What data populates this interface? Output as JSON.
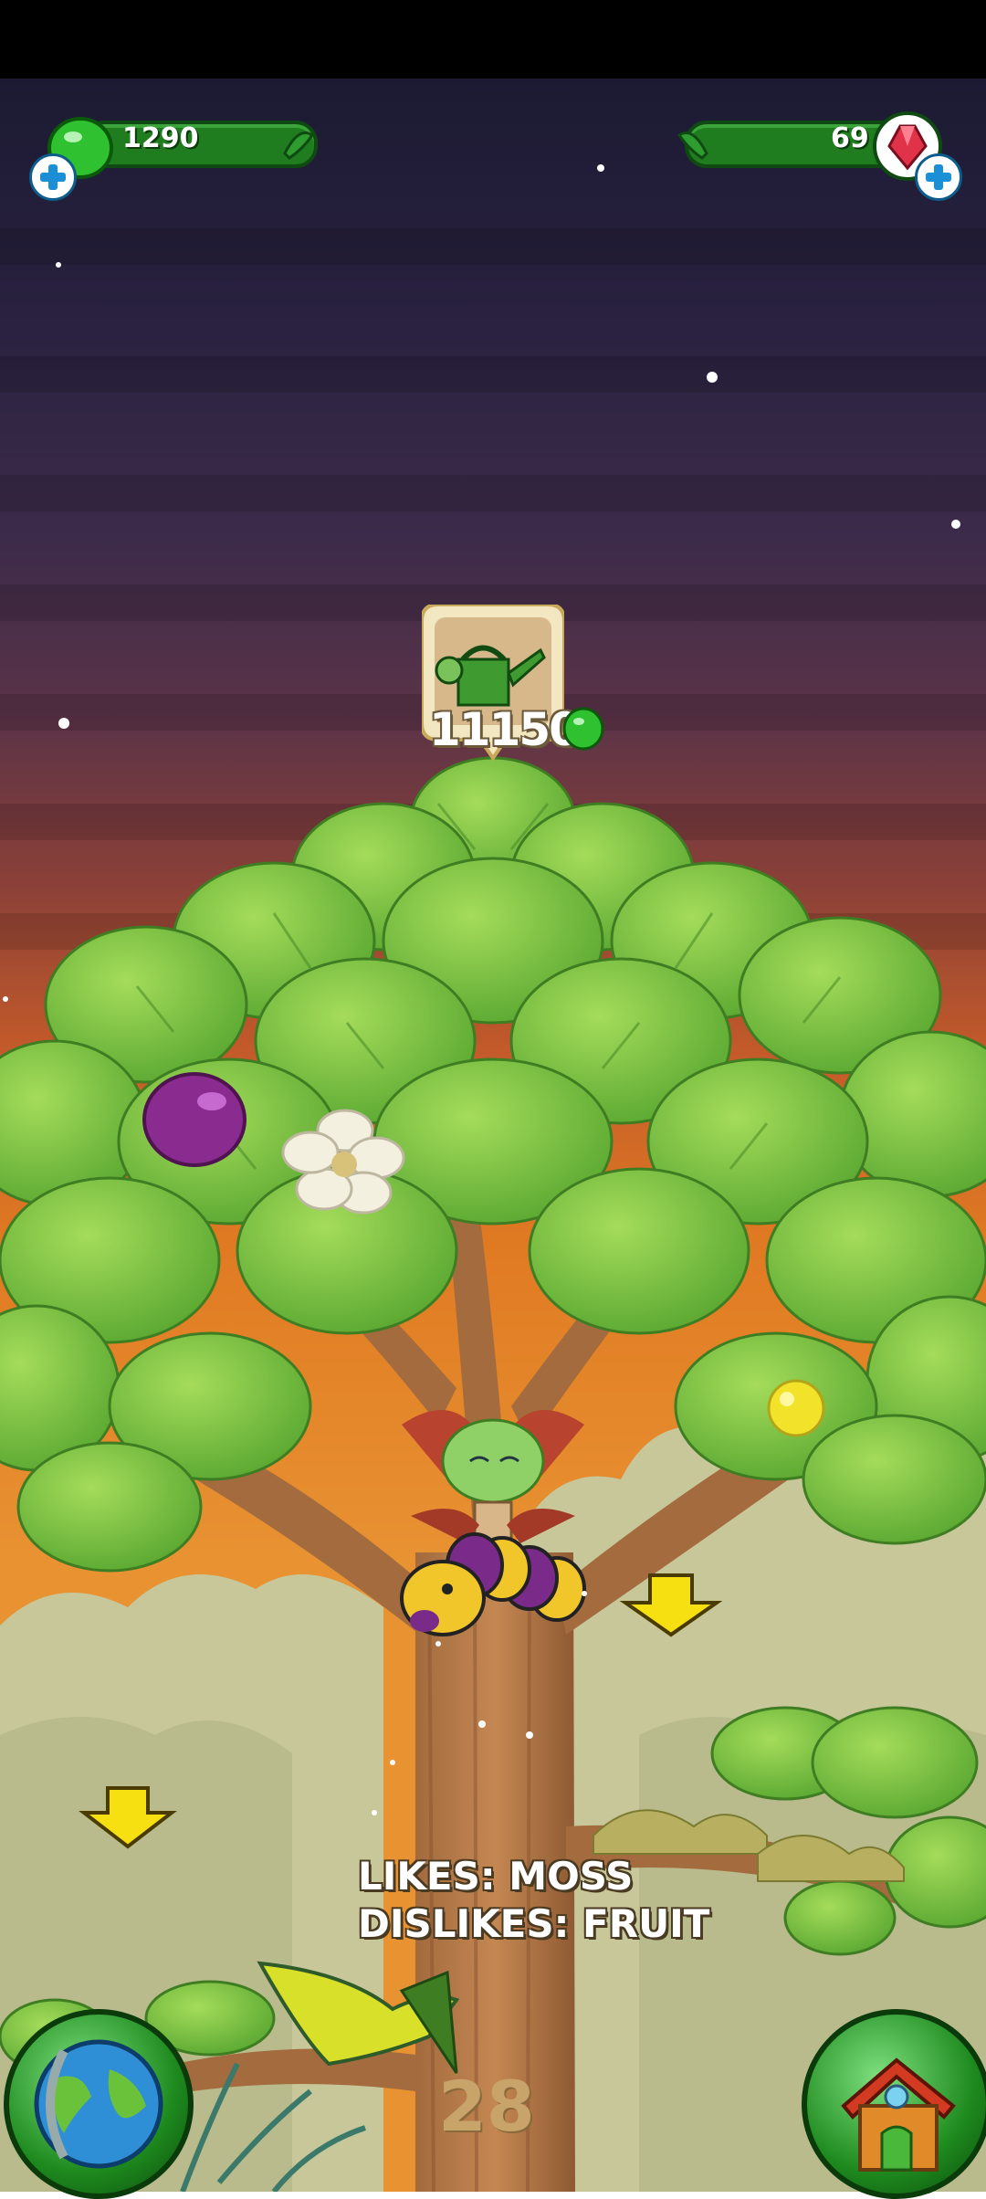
{
  "resources": {
    "jelly": {
      "amount": "1290",
      "icon": "green-jelly-icon"
    },
    "gems": {
      "amount": "69",
      "icon": "red-gem-icon"
    }
  },
  "shop_item": {
    "icon": "watering-can-icon",
    "price": "11150",
    "currency_icon": "green-jelly-icon"
  },
  "creature_info": {
    "likes": "LIKES: MOSS",
    "dislikes": "DISLIKES: FRUIT"
  },
  "level": "28",
  "nav": {
    "world_button_icon": "globe-icon",
    "home_button_icon": "house-icon"
  },
  "colors": {
    "accent_green": "#2e9c2e",
    "sky_top": "#1e1b33",
    "sky_bottom": "#e07a22"
  }
}
